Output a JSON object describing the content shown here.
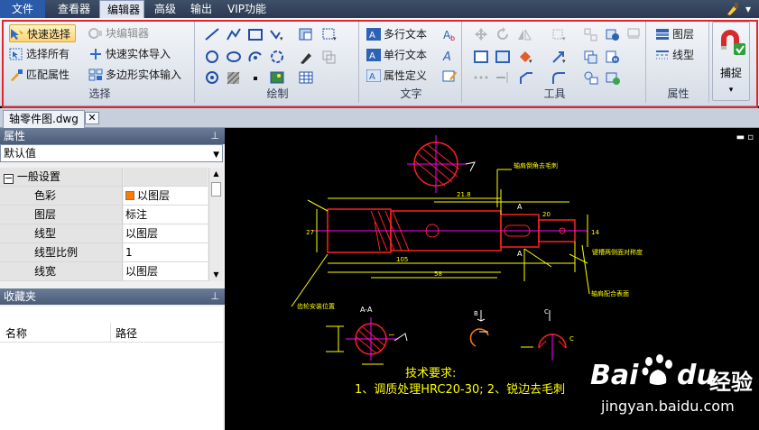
{
  "menubar": {
    "items": [
      "文件",
      "查看器",
      "编辑器",
      "高级",
      "输出",
      "VIP功能"
    ],
    "active": "编辑器"
  },
  "ribbon": {
    "select": {
      "title": "选择",
      "quick_select": "快速选择",
      "block_editor": "块编辑器",
      "select_all": "选择所有",
      "quick_entity_import": "快速实体导入",
      "match_props": "匹配属性",
      "polygon_entity_input": "多边形实体输入"
    },
    "draw": {
      "title": "绘制"
    },
    "text": {
      "title": "文字",
      "mtext": "多行文本",
      "stext": "单行文本",
      "attdef": "属性定义"
    },
    "tools": {
      "title": "工具"
    },
    "props": {
      "title": "属性",
      "layer": "图层",
      "linetype": "线型"
    },
    "snap": {
      "label": "捕捉"
    }
  },
  "document": {
    "tab_name": "轴零件图.dwg",
    "close_glyph": "✕"
  },
  "properties_panel": {
    "title": "属性",
    "pin": "ⵒ",
    "selector_value": "默认值",
    "section": "一般设置",
    "rows": [
      {
        "key": "色彩",
        "value": "以图层"
      },
      {
        "key": "图层",
        "value": "标注"
      },
      {
        "key": "线型",
        "value": "以图层"
      },
      {
        "key": "线型比例",
        "value": "1"
      },
      {
        "key": "线宽",
        "value": "以图层"
      }
    ]
  },
  "favorites_panel": {
    "title": "收藏夹",
    "col_name": "名称",
    "col_path": "路径"
  },
  "drawing": {
    "section_label": "A-A",
    "tech_title": "技术要求:",
    "tech_line": "1、调质处理HRC20-30;   2、锐边去毛刺",
    "callout_1": "轴肩倒角去毛刺",
    "callout_2": "键槽两侧面对称度",
    "callout_3": "轴肩配合表面",
    "callout_4": "齿轮安装位置",
    "dims": {
      "d1": "21.8",
      "d2": "105",
      "d3": "58",
      "d4": "27",
      "d5": "14",
      "d6": "20"
    }
  },
  "watermark": {
    "brand_left": "Bai",
    "brand_right": "du",
    "brand_cn": "经验",
    "url": "jingyan.baidu.com"
  },
  "colors": {
    "cad_yellow": "#ffff00",
    "cad_red": "#ff2020",
    "cad_magenta": "#ff00ff",
    "cad_white": "#ffffff",
    "ribbon_highlight": "#ffd36e",
    "frame_red": "#e2252b"
  }
}
